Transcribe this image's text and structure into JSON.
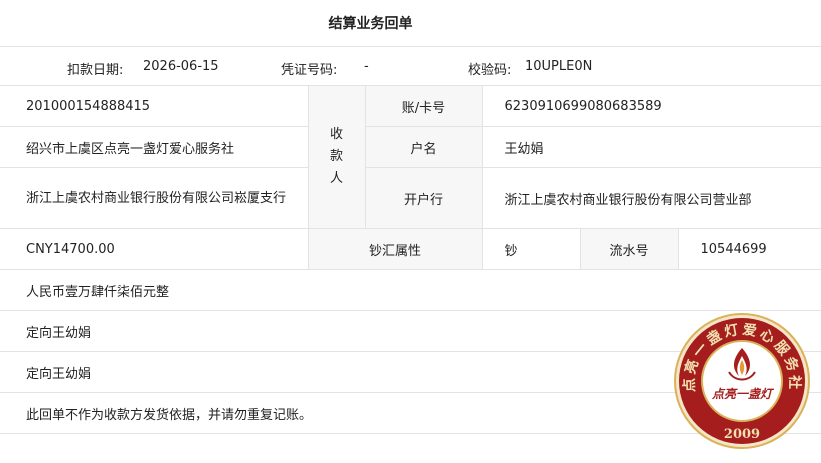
{
  "title": "结算业务回单",
  "meta": {
    "date_label": "扣款日期:",
    "date_value": "2026-06-15",
    "voucher_label": "凭证号码:",
    "voucher_value": "-",
    "check_label": "校验码:",
    "check_value": "10UPLE0N"
  },
  "payer": {
    "account": "201000154888415",
    "name": "绍兴市上虞区点亮一盏灯爱心服务社",
    "bank": "浙江上虞农村商业银行股份有限公司崧厦支行"
  },
  "payee": {
    "side_label": "收款人",
    "account_label": "账/卡号",
    "account_value": "6230910699080683589",
    "name_label": "户名",
    "name_value": "王幼娟",
    "bank_label": "开户行",
    "bank_value": "浙江上虞农村商业银行股份有限公司营业部"
  },
  "amount": {
    "value": "CNY14700.00",
    "fx_label": "钞汇属性",
    "fx_value": "钞",
    "serial_label": "流水号",
    "serial_value": "10544699",
    "uppercase": "人民币壹万肆仟柒佰元整"
  },
  "remarks": {
    "purpose": "定向王幼娟",
    "memo": "定向王幼娟",
    "notice": "此回单不作为收款方发货依据，并请勿重复记账。"
  },
  "seal": {
    "ring_text": "点亮一盏灯爱心服务社",
    "center_text": "点亮一盏灯",
    "year": "2009",
    "color": "#a51d1d",
    "gold": "#d9b25a"
  }
}
